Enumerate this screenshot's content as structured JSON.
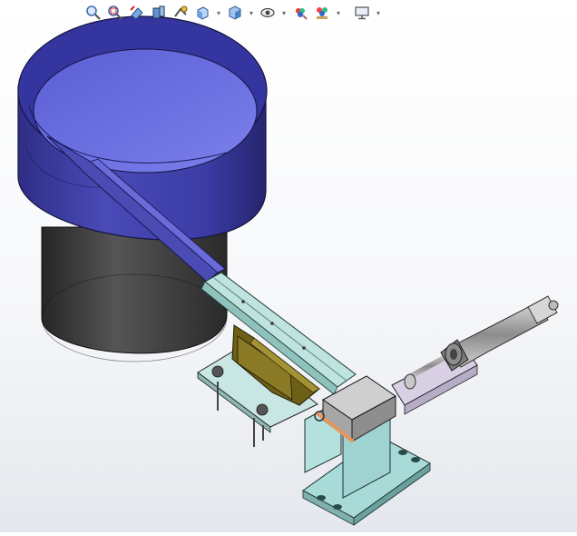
{
  "window": {
    "kind": "3D CAD assembly viewport"
  },
  "toolbar": {
    "buttons": [
      {
        "name": "zoom-to-fit-icon",
        "has_dropdown": false
      },
      {
        "name": "zoom-to-area-icon",
        "has_dropdown": false
      },
      {
        "name": "previous-view-icon",
        "has_dropdown": false
      },
      {
        "name": "section-view-icon",
        "has_dropdown": false
      },
      {
        "name": "dynamic-annotation-views-icon",
        "has_dropdown": false
      },
      {
        "name": "view-orientation-icon",
        "has_dropdown": true
      },
      {
        "name": "display-style-icon",
        "has_dropdown": true
      },
      {
        "name": "hide-show-items-icon",
        "has_dropdown": true
      },
      {
        "name": "edit-appearance-icon",
        "has_dropdown": false
      },
      {
        "name": "apply-scene-icon",
        "has_dropdown": true
      },
      {
        "name": "view-settings-icon",
        "has_dropdown": true
      }
    ]
  },
  "model": {
    "components": [
      "vibratory-bowl",
      "bowl-base",
      "linear-feeder-track",
      "vibrator-mount",
      "transfer-block",
      "pneumatic-cylinder"
    ],
    "colors": {
      "bowl_body": "#3f3fa8",
      "bowl_inner": "#6b6fe0",
      "base": "#3c3c3c",
      "track": "#b5dcd6",
      "vibrator": "#7a6a1e",
      "block": "#a8dadc",
      "steel": "#9a9a9a",
      "copper": "#e89a55"
    }
  }
}
